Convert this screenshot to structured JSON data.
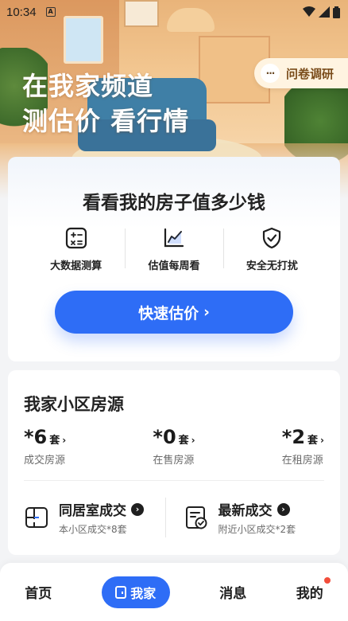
{
  "status_bar": {
    "time": "10:34",
    "a_badge": "A"
  },
  "hero": {
    "title_line1": "在我家频道",
    "title_line2": "测估价 看行情"
  },
  "survey": {
    "dots": "···",
    "label": "问卷调研"
  },
  "valuation_card": {
    "heading": "看看我的房子值多少钱",
    "features": [
      {
        "label": "大数据测算",
        "icon": "calculator-icon"
      },
      {
        "label": "估值每周看",
        "icon": "trend-chart-icon"
      },
      {
        "label": "安全无打扰",
        "icon": "shield-check-icon"
      }
    ],
    "button_label": "快速估价",
    "button_arrow": "›"
  },
  "community_card": {
    "title": "我家小区房源",
    "stats": [
      {
        "value": "*6",
        "unit": "套",
        "label": "成交房源"
      },
      {
        "value": "*0",
        "unit": "套",
        "label": "在售房源"
      },
      {
        "value": "*2",
        "unit": "套",
        "label": "在租房源"
      }
    ],
    "chevron": "›",
    "links": [
      {
        "title": "同居室成交",
        "subtitle": "本小区成交*8套",
        "icon": "floorplan-icon"
      },
      {
        "title": "最新成交",
        "subtitle": "附近小区成交*2套",
        "icon": "check-document-icon"
      }
    ],
    "go_arrow": "›"
  },
  "bottom_nav": {
    "items": [
      {
        "label": "首页"
      },
      {
        "label": "我家",
        "active": true
      },
      {
        "label": "消息"
      },
      {
        "label": "我的",
        "has_badge": true
      }
    ]
  },
  "colors": {
    "accent": "#2e6df6",
    "badge": "#f24e3b",
    "survey_bg": "#fff4e1"
  }
}
